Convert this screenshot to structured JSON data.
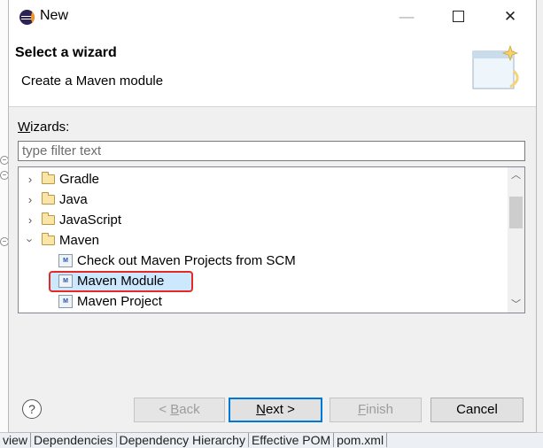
{
  "window": {
    "title": "New",
    "app_icon": "eclipse-icon"
  },
  "header": {
    "title": "Select a wizard",
    "description": "Create a Maven module",
    "image_icon": "wizard-banner-icon"
  },
  "filter": {
    "label_mnemonic": "W",
    "label_rest": "izards:",
    "placeholder": "type filter text",
    "value": ""
  },
  "tree": {
    "items": [
      {
        "label": "Gradle",
        "kind": "folder",
        "expanded": false
      },
      {
        "label": "Java",
        "kind": "folder",
        "expanded": false
      },
      {
        "label": "JavaScript",
        "kind": "folder",
        "expanded": false
      },
      {
        "label": "Maven",
        "kind": "folder",
        "expanded": true
      },
      {
        "label": "Check out Maven Projects from SCM",
        "kind": "item"
      },
      {
        "label": "Maven Module",
        "kind": "item",
        "selected": true
      },
      {
        "label": "Maven Project",
        "kind": "item"
      }
    ]
  },
  "buttons": {
    "back_pre": "< ",
    "back_mnemonic": "B",
    "back_rest": "ack",
    "next_mnemonic": "N",
    "next_rest": "ext >",
    "finish_mnemonic": "F",
    "finish_rest": "inish",
    "cancel": "Cancel"
  },
  "background_tabs": [
    "view",
    "Dependencies",
    "Dependency Hierarchy",
    "Effective POM",
    "pom.xml"
  ],
  "colors": {
    "selection": "#cce8ff",
    "highlight_box": "#e42a28",
    "default_button": "#0078d7"
  }
}
